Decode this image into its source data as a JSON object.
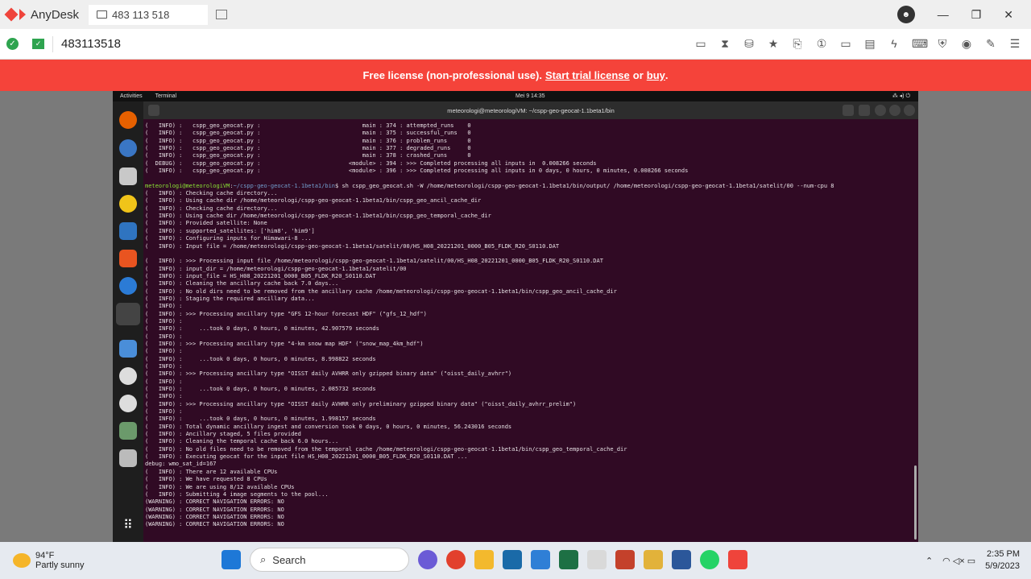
{
  "anydesk": {
    "app_name": "AnyDesk",
    "tab_label": "483 113 518",
    "address": "483113518",
    "banner": {
      "prefix": "Free license (non-professional use).",
      "link1": "Start trial license",
      "mid": "or",
      "link2": "buy",
      "suffix": "."
    },
    "colors": {
      "brand": "#ef443b",
      "banner": "#f5433a"
    }
  },
  "ubuntu": {
    "activities": "Activities",
    "app": "Terminal",
    "clock": "Mei 9  14:35",
    "terminal_title": "meteorologi@meteorologiVM: ~/cspp-geo-geocat-1.1beta1/bin",
    "prompt_user": "meteorologi@meteorologiVM",
    "prompt_path": "~/cspp-geo-geocat-1.1beta1/bin",
    "prompt_cmd": "$ sh cspp_geo_geocat.sh -W /home/meteorologi/cspp-geo-geocat-1.1beta1/bin/output/ /home/meteorologi/cspp-geo-geocat-1.1beta1/satelit/00 --num-cpu 8",
    "lines_before": [
      "(   INFO) :   cspp_geo_geocat.py :                              main : 374 : attempted_runs    0",
      "(   INFO) :   cspp_geo_geocat.py :                              main : 375 : successful_runs   0",
      "(   INFO) :   cspp_geo_geocat.py :                              main : 376 : problem_runs      0",
      "(   INFO) :   cspp_geo_geocat.py :                              main : 377 : degraded_runs     0",
      "(   INFO) :   cspp_geo_geocat.py :                              main : 378 : crashed_runs      0",
      "(  DEBUG) :   cspp_geo_geocat.py :                          <module> : 394 : >>> Completed processing all inputs in  0.008266 seconds",
      "(   INFO) :   cspp_geo_geocat.py :                          <module> : 396 : >>> Completed processing all inputs in 0 days, 0 hours, 0 minutes, 0.008266 seconds",
      ""
    ],
    "lines_after": [
      "(   INFO) : Checking cache directory...",
      "(   INFO) : Using cache dir /home/meteorologi/cspp-geo-geocat-1.1beta1/bin/cspp_geo_ancil_cache_dir",
      "(   INFO) : Checking cache directory...",
      "(   INFO) : Using cache dir /home/meteorologi/cspp-geo-geocat-1.1beta1/bin/cspp_geo_temporal_cache_dir",
      "(   INFO) : Provided satellite: None",
      "(   INFO) : supported_satellites: ['him8', 'him9']",
      "(   INFO) : Configuring inputs for Himawari-8 ...",
      "(   INFO) : Input file = /home/meteorologi/cspp-geo-geocat-1.1beta1/satelit/00/HS_H08_20221201_0000_B05_FLDK_R20_S0110.DAT",
      "",
      "(   INFO) : >>> Processing input file /home/meteorologi/cspp-geo-geocat-1.1beta1/satelit/00/HS_H08_20221201_0000_B05_FLDK_R20_S0110.DAT",
      "(   INFO) : input_dir = /home/meteorologi/cspp-geo-geocat-1.1beta1/satelit/00",
      "(   INFO) : input_file = HS_H08_20221201_0000_B05_FLDK_R20_S0110.DAT",
      "(   INFO) : Cleaning the ancillary cache back 7.0 days...",
      "(   INFO) : No old dirs need to be removed from the ancillary cache /home/meteorologi/cspp-geo-geocat-1.1beta1/bin/cspp_geo_ancil_cache_dir",
      "(   INFO) : Staging the required ancillary data...",
      "(   INFO) :",
      "(   INFO) : >>> Processing ancillary type \"GFS 12-hour forecast HDF\" (\"gfs_12_hdf\")",
      "(   INFO) :",
      "(   INFO) :     ...took 0 days, 0 hours, 0 minutes, 42.907579 seconds",
      "(   INFO) :",
      "(   INFO) : >>> Processing ancillary type \"4-km snow map HDF\" (\"snow_map_4km_hdf\")",
      "(   INFO) :",
      "(   INFO) :     ...took 0 days, 0 hours, 0 minutes, 8.998822 seconds",
      "(   INFO) :",
      "(   INFO) : >>> Processing ancillary type \"OISST daily AVHRR only gzipped binary data\" (\"oisst_daily_avhrr\")",
      "(   INFO) :",
      "(   INFO) :     ...took 0 days, 0 hours, 0 minutes, 2.085732 seconds",
      "(   INFO) :",
      "(   INFO) : >>> Processing ancillary type \"OISST daily AVHRR only preliminary gzipped binary data\" (\"oisst_daily_avhrr_prelim\")",
      "(   INFO) :",
      "(   INFO) :     ...took 0 days, 0 hours, 0 minutes, 1.998157 seconds",
      "(   INFO) : Total dynamic ancillary ingest and conversion took 0 days, 0 hours, 0 minutes, 56.243016 seconds",
      "(   INFO) : Ancillary staged, 5 files provided",
      "(   INFO) : Cleaning the temporal cache back 6.0 hours...",
      "(   INFO) : No old files need to be removed from the temporal cache /home/meteorologi/cspp-geo-geocat-1.1beta1/bin/cspp_geo_temporal_cache_dir",
      "(   INFO) : Executing geocat for the input file HS_H08_20221201_0000_B05_FLDK_R20_S0110.DAT ...",
      "debug: wmo_sat_id=167",
      "(   INFO) : There are 12 available CPUs",
      "(   INFO) : We have requested 8 CPUs",
      "(   INFO) : We are using 8/12 available CPUs",
      "(   INFO) : Submitting 4 image segments to the pool...",
      "(WARNING) : CORRECT NAVIGATION ERRORS: NO",
      "(WARNING) : CORRECT NAVIGATION ERRORS: NO",
      "(WARNING) : CORRECT NAVIGATION ERRORS: NO",
      "(WARNING) : CORRECT NAVIGATION ERRORS: NO"
    ],
    "terminal_bg": "#300a24"
  },
  "taskbar": {
    "temp": "94°F",
    "weather": "Partly sunny",
    "search_placeholder": "Search",
    "time": "2:35 PM",
    "date": "5/9/2023"
  }
}
